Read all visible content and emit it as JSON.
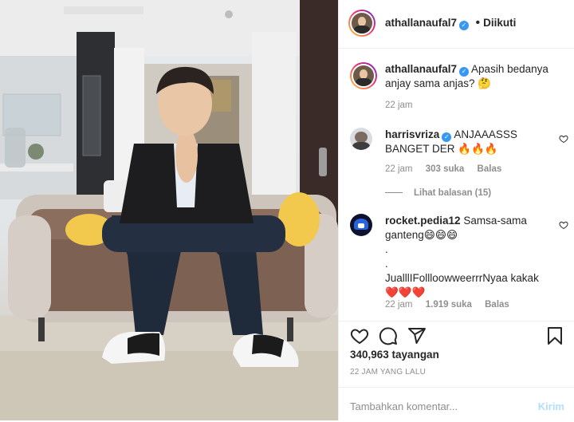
{
  "header": {
    "username": "athallanaufal7",
    "separator": "•",
    "follow_status": "Diikuti"
  },
  "caption": {
    "username": "athallanaufal7",
    "text": "Apasih bedanya anjay sama anjas? 🤔",
    "time": "22 jam"
  },
  "comments": [
    {
      "username": "harrisvriza",
      "text": "ANJAAASSS BANGET DER 🔥🔥🔥",
      "time": "22 jam",
      "likes": "303 suka",
      "reply_label": "Balas"
    },
    {
      "username": "rocket.pedia12",
      "text_lines": [
        "Samsa-sama ganteng😄😄😄",
        ".",
        ".",
        "JualllIFollloowweerrrNyaa kakak",
        "❤️❤️❤️"
      ],
      "time": "22 jam",
      "likes": "1.919 suka",
      "reply_label": "Balas"
    }
  ],
  "view_replies": "Lihat balasan (15)",
  "stats": {
    "views": "340,963 tayangan",
    "posted": "22 JAM YANG LALU"
  },
  "comment_box": {
    "placeholder": "Tambahkan komentar...",
    "submit_label": "Kirim"
  },
  "colors": {
    "verified": "#3897f0",
    "muted": "#8e8e8e",
    "submit_disabled": "#b2dffc"
  },
  "icons": [
    "heart-icon",
    "comment-icon",
    "share-icon",
    "bookmark-icon",
    "verified-badge-icon"
  ]
}
